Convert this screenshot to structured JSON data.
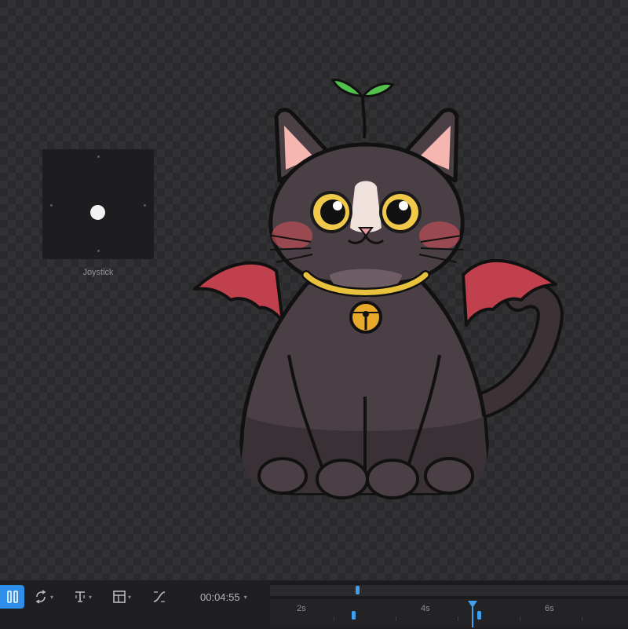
{
  "joystick": {
    "label": "Joystick"
  },
  "toolbar": {
    "pause_icon": "pause-icon",
    "tools": [
      {
        "name": "loop-icon"
      },
      {
        "name": "text-cursor-icon"
      },
      {
        "name": "layout-icon"
      },
      {
        "name": "curve-icon"
      }
    ],
    "time": "00:04:55"
  },
  "timeline": {
    "ticks": [
      "2s",
      "4s",
      "6s"
    ]
  },
  "colors": {
    "accent": "#2f8fe8",
    "canvas_dark": "#2a2a2d",
    "canvas_light": "#323235"
  }
}
